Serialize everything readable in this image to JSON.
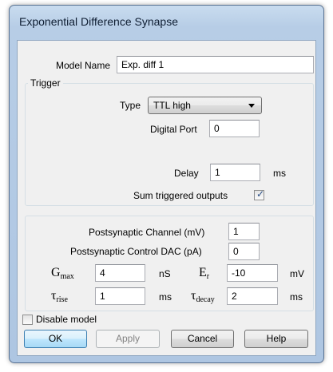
{
  "window": {
    "title": "Exponential Difference Synapse"
  },
  "model_name": {
    "label": "Model Name",
    "value": "Exp. diff 1"
  },
  "trigger": {
    "group_label": "Trigger",
    "type_label": "Type",
    "type_value": "TTL high",
    "digital_port_label": "Digital Port",
    "digital_port_value": "0",
    "delay_label": "Delay",
    "delay_value": "1",
    "delay_unit": "ms",
    "sum_outputs_label": "Sum triggered outputs",
    "sum_outputs_checked": true,
    "check_glyph": "✓"
  },
  "params": {
    "postsyn_channel_label": "Postsynaptic Channel (mV)",
    "postsyn_channel_value": "1",
    "postsyn_dac_label": "Postsynaptic Control DAC (pA)",
    "postsyn_dac_value": "0",
    "gmax_symbol": "G",
    "gmax_sub": "max",
    "gmax_value": "4",
    "gmax_unit": "nS",
    "er_symbol": "E",
    "er_sub": "r",
    "er_value": "-10",
    "er_unit": "mV",
    "trise_symbol": "τ",
    "trise_sub": "rise",
    "trise_value": "1",
    "trise_unit": "ms",
    "tdecay_symbol": "τ",
    "tdecay_sub": "decay",
    "tdecay_value": "2",
    "tdecay_unit": "ms"
  },
  "disable_model": {
    "label": "Disable model",
    "checked": false
  },
  "buttons": {
    "ok": "OK",
    "apply": "Apply",
    "cancel": "Cancel",
    "help": "Help"
  }
}
